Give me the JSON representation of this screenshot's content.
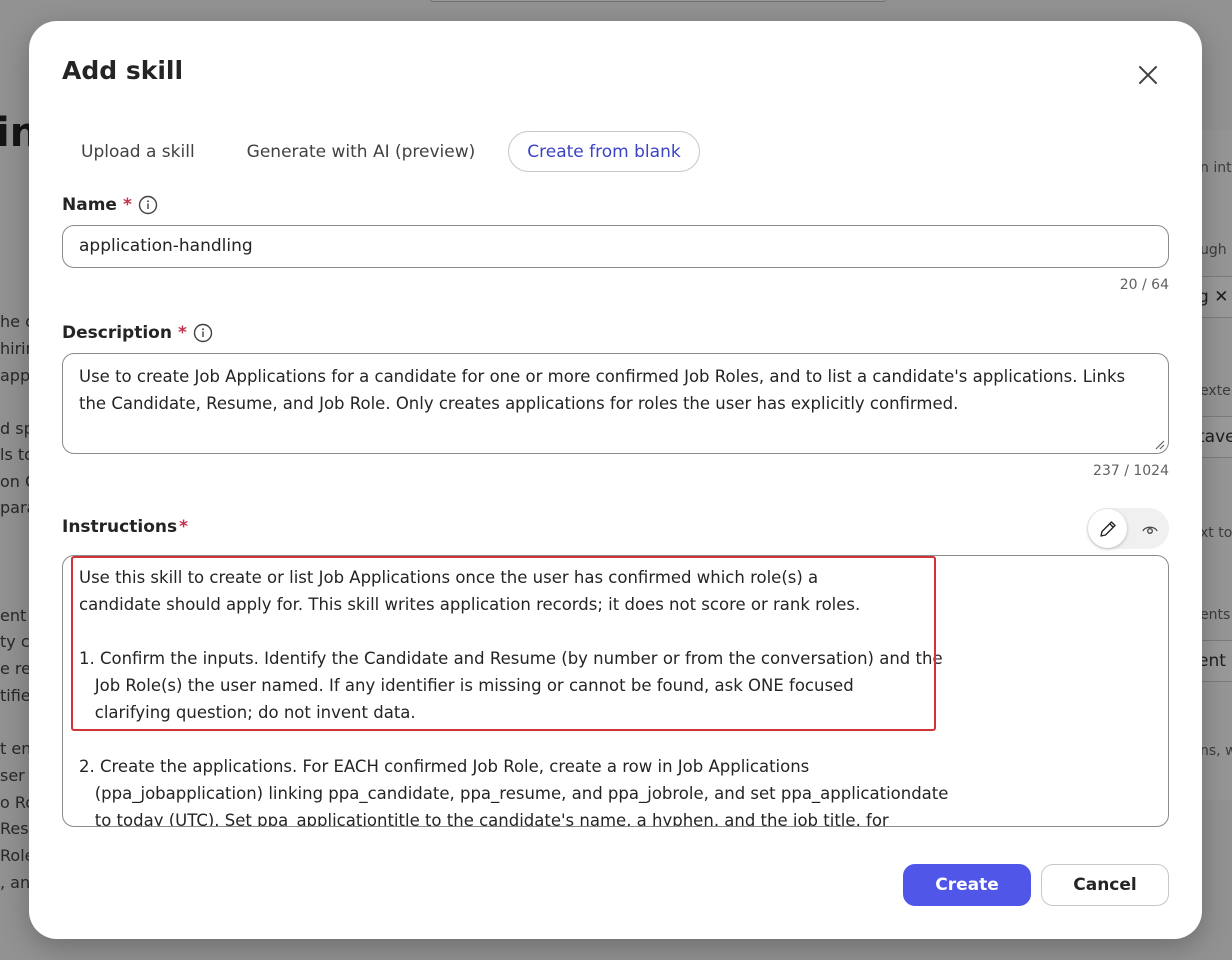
{
  "background": {
    "heading": "in",
    "left_lines": [
      "he ce",
      "hirin",
      "app",
      "d sp",
      "ls to",
      "on C",
      "parat",
      "ent",
      "ty c",
      "e res",
      "tifie",
      "t en",
      "ser s",
      "o Ro",
      "Res",
      "Role",
      ", an"
    ],
    "right_lines": [
      "n int",
      "ugh",
      "exte",
      "xt to",
      "ents",
      "ns, w"
    ],
    "right_fields": [
      "g ✕",
      "tave",
      "ent"
    ]
  },
  "dialog": {
    "title": "Add skill",
    "close_label": "✕"
  },
  "tabs": [
    {
      "label": "Upload a skill",
      "active": false
    },
    {
      "label": "Generate with AI (preview)",
      "active": false
    },
    {
      "label": "Create from blank",
      "active": true
    }
  ],
  "name_field": {
    "label": "Name",
    "required_mark": "*",
    "value": "application-handling",
    "counter": "20 / 64"
  },
  "description_field": {
    "label": "Description",
    "required_mark": "*",
    "value": "Use to create Job Applications for a candidate for one or more confirmed Job Roles, and to list a candidate's applications. Links the Candidate, Resume, and Job Role. Only creates applications for roles the user has explicitly confirmed.",
    "counter": "237 / 1024"
  },
  "instructions_field": {
    "label": "Instructions",
    "required_mark": "*",
    "value": "Use this skill to create or list Job Applications once the user has confirmed which role(s) a\ncandidate should apply for. This skill writes application records; it does not score or rank roles.\n\n1. Confirm the inputs. Identify the Candidate and Resume (by number or from the conversation) and the\n   Job Role(s) the user named. If any identifier is missing or cannot be found, ask ONE focused\n   clarifying question; do not invent data.\n\n2. Create the applications. For EACH confirmed Job Role, create a row in Job Applications\n   (ppa_jobapplication) linking ppa_candidate, ppa_resume, and ppa_jobrole, and set ppa_applicationdate\n   to today (UTC). Set ppa_applicationtitle to the candidate's name, a hyphen, and the job title, for"
  },
  "mode_toggle": {
    "edit_icon": "pencil-icon",
    "preview_icon": "eye-icon"
  },
  "actions": {
    "create_label": "Create",
    "cancel_label": "Cancel"
  },
  "colors": {
    "accent": "#4f56e8",
    "active_tab_text": "#3b43c6",
    "required": "#c4314b",
    "highlight_border": "#d13438"
  }
}
